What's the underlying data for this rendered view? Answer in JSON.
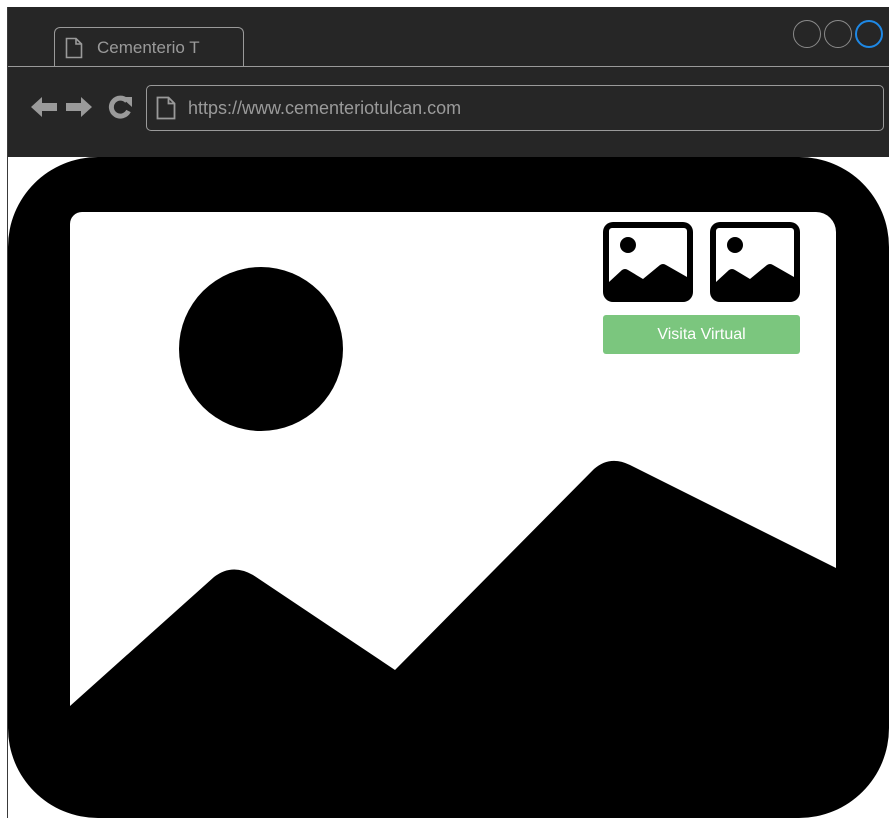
{
  "browser": {
    "tab_title": "Cementerio T",
    "url": "https://www.cementeriotulcan.com",
    "window_buttons": [
      "minimize",
      "maximize",
      "close"
    ]
  },
  "icons": {
    "tab": "document-icon",
    "back": "arrow-left-icon",
    "forward": "arrow-right-icon",
    "reload": "reload-icon",
    "url": "document-icon",
    "hero": "image-placeholder-icon",
    "thumbnails": [
      "image-placeholder-icon",
      "image-placeholder-icon"
    ]
  },
  "page": {
    "visit_button_label": "Visita Virtual"
  },
  "colors": {
    "chrome_background": "#262626",
    "chrome_text": "#9a9a9a",
    "close_button_accent": "#1e88e5",
    "visit_button": "#7bc67e"
  }
}
